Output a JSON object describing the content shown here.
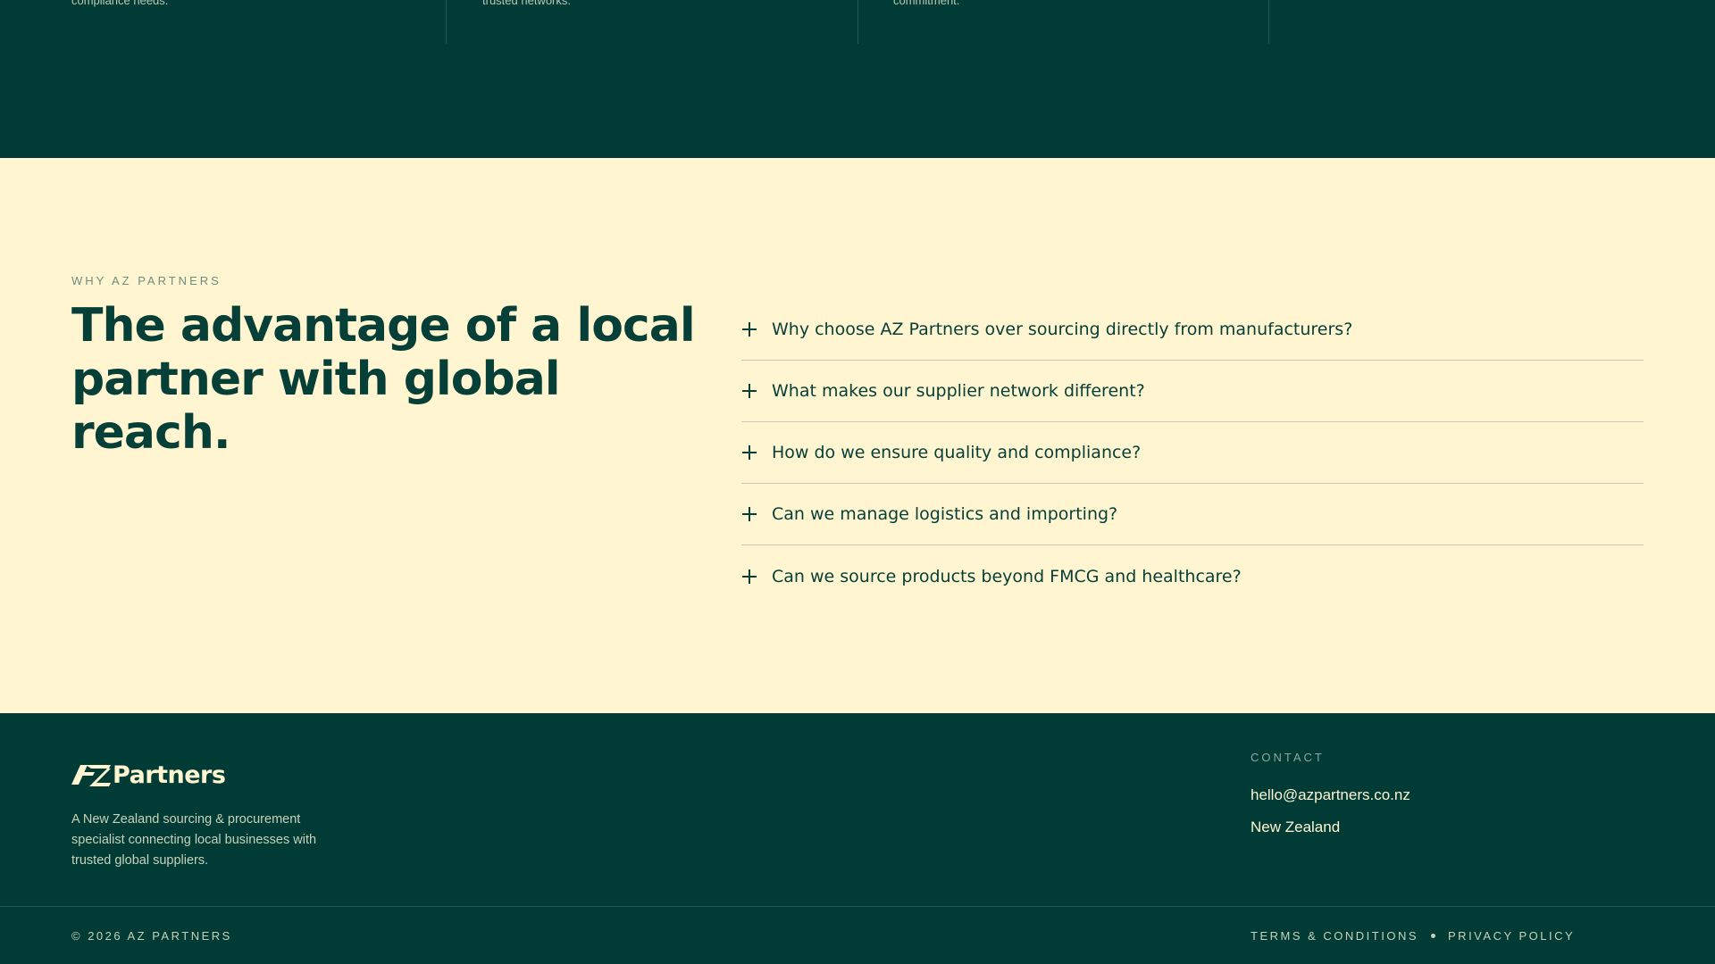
{
  "top_strip": {
    "columns": [
      {
        "text": "compliance needs."
      },
      {
        "text": "trusted networks."
      },
      {
        "text": "commitment."
      }
    ]
  },
  "why": {
    "eyebrow": "WHY AZ PARTNERS",
    "headline": "The advantage of a local partner with global reach.",
    "faq": [
      {
        "question": "Why choose AZ Partners over sourcing directly from manufacturers?"
      },
      {
        "question": "What makes our supplier network different?"
      },
      {
        "question": "How do we ensure quality and compliance?"
      },
      {
        "question": "Can we manage logistics and importing?"
      },
      {
        "question": "Can we source products beyond FMCG and healthcare?"
      }
    ]
  },
  "footer": {
    "logo_text": "Partners",
    "logo_mark": "AZ",
    "description": "A New Zealand sourcing & procurement specialist connecting local businesses with trusted global suppliers.",
    "contact": {
      "title": "CONTACT",
      "email": "hello@azpartners.co.nz",
      "location": "New Zealand"
    },
    "copyright": "© 2026 AZ PARTNERS",
    "legal": {
      "terms": "TERMS & CONDITIONS",
      "privacy": "PRIVACY POLICY"
    }
  },
  "colors": {
    "dark_green": "#003b36",
    "cream": "#fff5d1",
    "heading_green": "#063f37"
  }
}
